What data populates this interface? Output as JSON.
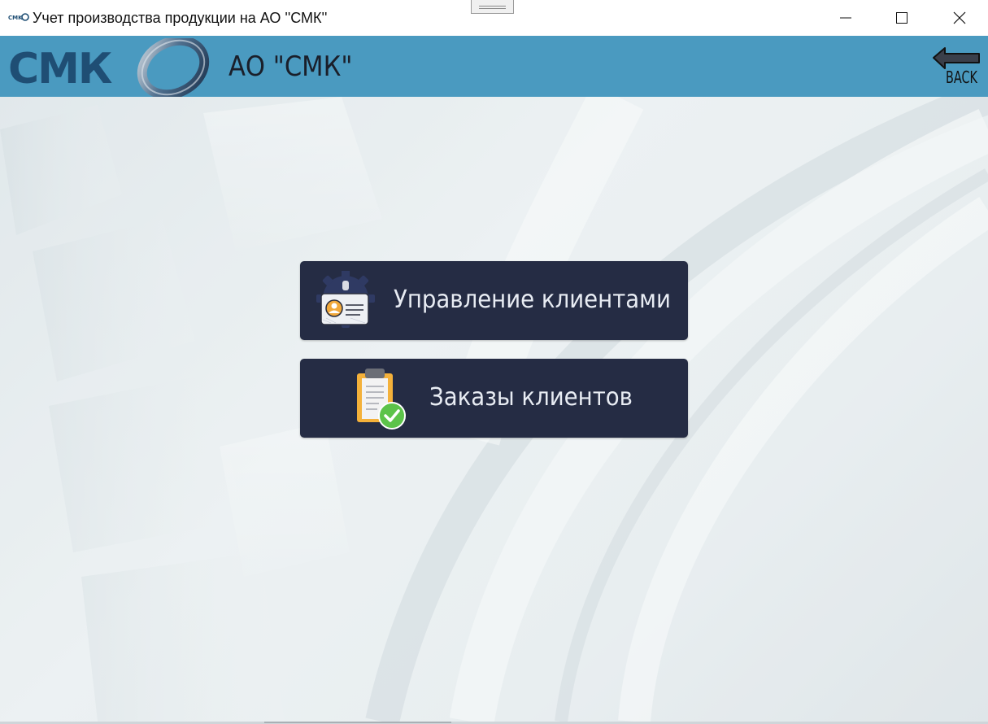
{
  "window": {
    "title": "Учет производства продукции на АО ''СМК''",
    "controls": {
      "minimize_icon": "minimize-icon",
      "maximize_icon": "maximize-icon",
      "close_icon": "close-icon"
    }
  },
  "header": {
    "logo_text": "СМК",
    "company_name": "АО \"СМК\"",
    "back_label": "BACK",
    "background_color": "#4a9ac0"
  },
  "menu": {
    "items": [
      {
        "label": "Управление клиентами",
        "icon": "client-card-gear-icon"
      },
      {
        "label": "Заказы клиентов",
        "icon": "clipboard-check-icon"
      }
    ],
    "button_color": "#252c44"
  }
}
